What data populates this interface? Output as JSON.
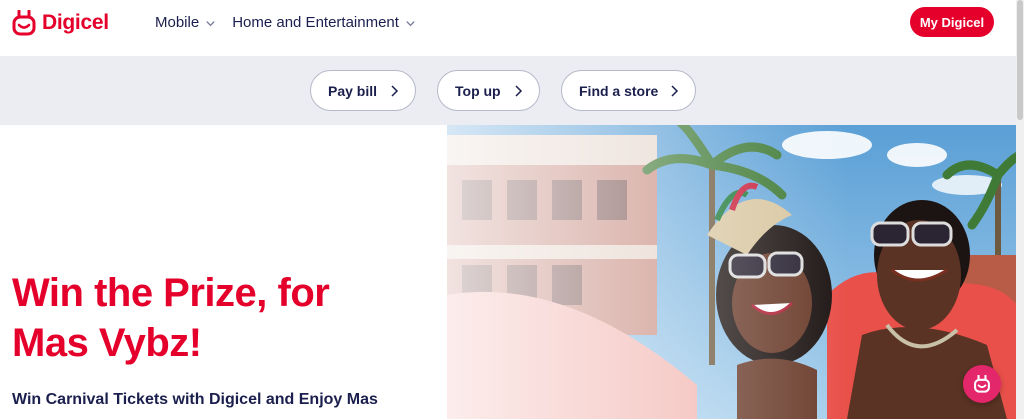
{
  "brand": {
    "name": "Digicel",
    "color": "#e4002b",
    "icon": "digicel-smile-logo"
  },
  "nav": {
    "items": [
      {
        "label": "Mobile",
        "icon": "chevron-down-icon"
      },
      {
        "label": "Home and Entertainment",
        "icon": "chevron-down-icon"
      }
    ],
    "cta_label": "My Digicel"
  },
  "quick_links": [
    {
      "label": "Pay bill",
      "icon": "chevron-right-icon"
    },
    {
      "label": "Top up",
      "icon": "chevron-right-icon"
    },
    {
      "label": "Find a store",
      "icon": "chevron-right-icon"
    }
  ],
  "hero": {
    "title_line1": "Win the Prize, for",
    "title_line2": "Mas Vybz!",
    "subtitle": "Win Carnival Tickets with Digicel and Enjoy Mas",
    "image": "carnival-revellers-photo"
  },
  "chat_button": {
    "icon": "digicel-chat-icon",
    "color": "#e4266a"
  },
  "colors": {
    "accent": "#e4002b",
    "navy": "#1b1f4d",
    "band": "#ecedf2"
  }
}
